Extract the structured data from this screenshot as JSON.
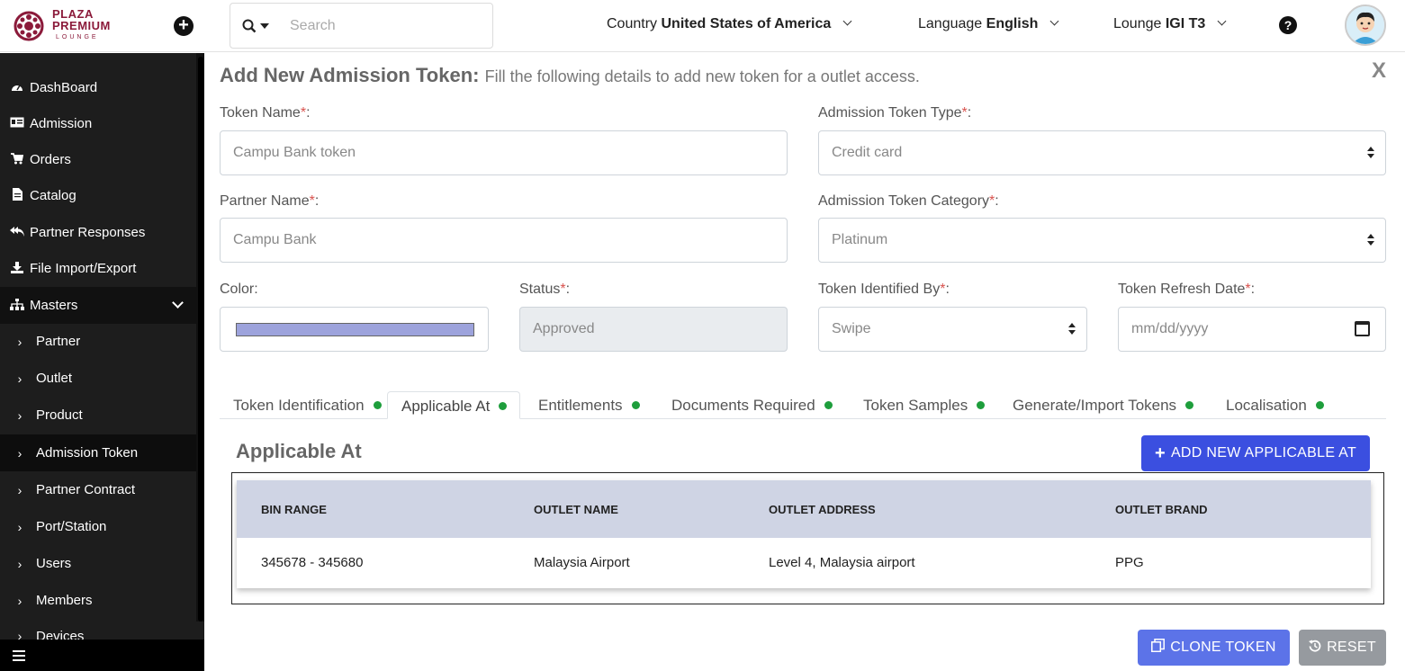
{
  "brand": {
    "line1": "PLAZA",
    "line2": "PREMIUM",
    "line3": "LOUNGE",
    "color": "#8b1a3a"
  },
  "header": {
    "search_placeholder": "Search",
    "country_label": "Country",
    "country_value": "United States of America",
    "language_label": "Language",
    "language_value": "English",
    "lounge_label": "Lounge",
    "lounge_value": "IGI T3"
  },
  "sidebar": {
    "items": [
      {
        "label": "DashBoard",
        "icon": "dashboard-icon"
      },
      {
        "label": "Admission",
        "icon": "id-card-icon"
      },
      {
        "label": "Orders",
        "icon": "cart-icon"
      },
      {
        "label": "Catalog",
        "icon": "file-icon"
      },
      {
        "label": "Partner Responses",
        "icon": "reply-all-icon"
      },
      {
        "label": "File Import/Export",
        "icon": "download-icon"
      },
      {
        "label": "Masters",
        "icon": "sitemap-icon"
      }
    ],
    "masters_children": [
      {
        "label": "Partner"
      },
      {
        "label": "Outlet"
      },
      {
        "label": "Product"
      },
      {
        "label": "Admission Token"
      },
      {
        "label": "Partner Contract"
      },
      {
        "label": "Port/Station"
      },
      {
        "label": "Users"
      },
      {
        "label": "Members"
      },
      {
        "label": "Devices"
      }
    ]
  },
  "form": {
    "title": "Add New Admission Token:",
    "subtitle": "Fill the following details to add new token for a outlet access.",
    "close": "X",
    "required_mark": "*",
    "token_name_label": "Token Name",
    "token_name_placeholder": "Campu Bank token",
    "token_type_label": "Admission Token Type",
    "token_type_value": "Credit card",
    "partner_name_label": "Partner Name",
    "partner_name_placeholder": "Campu Bank",
    "token_category_label": "Admission Token Category",
    "token_category_value": "Platinum",
    "color_label": "Color",
    "color_value": "#9da3dc",
    "status_label": "Status",
    "status_value": "Approved",
    "identified_by_label": "Token Identified By",
    "identified_by_value": "Swipe",
    "refresh_date_label": "Token Refresh Date",
    "refresh_date_placeholder": "mm/dd/yyyy"
  },
  "tabs": [
    {
      "label": "Token Identification"
    },
    {
      "label": "Applicable At"
    },
    {
      "label": "Entitlements"
    },
    {
      "label": "Documents Required"
    },
    {
      "label": "Token Samples"
    },
    {
      "label": "Generate/Import Tokens"
    },
    {
      "label": "Localisation"
    }
  ],
  "applicable": {
    "title": "Applicable At",
    "add_button": "ADD NEW APPLICABLE AT",
    "columns": [
      "BIN RANGE",
      "OUTLET NAME",
      "OUTLET ADDRESS",
      "OUTLET BRAND"
    ],
    "rows": [
      [
        "345678 - 345680",
        "Malaysia Airport",
        "Level 4, Malaysia airport",
        "PPG"
      ]
    ]
  },
  "actions": {
    "clone": "CLONE TOKEN",
    "reset": "RESET"
  },
  "colors": {
    "primary": "#3b4fe0",
    "status_dot": "#1e9e3c",
    "sidebar_bg": "#1d1d1d"
  }
}
